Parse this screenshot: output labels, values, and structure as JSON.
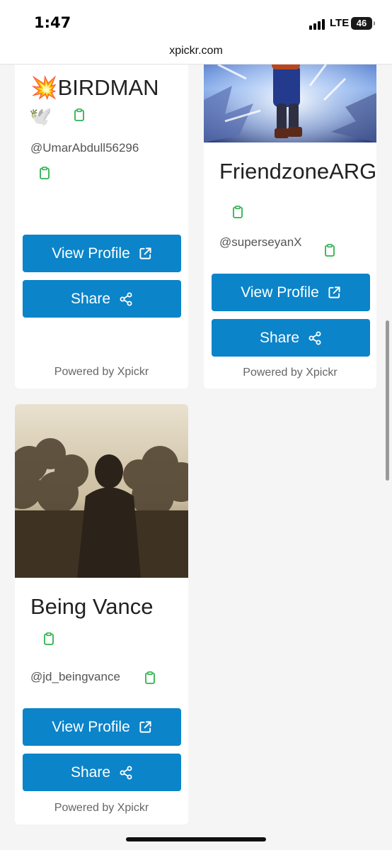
{
  "status": {
    "time": "1:47",
    "network": "LTE",
    "battery": "46"
  },
  "url": "xpickr.com",
  "cards": [
    {
      "name": "💥BIRDMAN",
      "emoji": "🕊️",
      "handle": "@UmarAbdull56296",
      "view_label": "View Profile",
      "share_label": "Share",
      "powered": "Powered by Xpickr"
    },
    {
      "name": "FriendzoneARG",
      "handle": "@superseyanX",
      "view_label": "View Profile",
      "share_label": "Share",
      "powered": "Powered by Xpickr"
    },
    {
      "name": "Being Vance",
      "handle": "@jd_beingvance",
      "view_label": "View Profile",
      "share_label": "Share",
      "powered": "Powered by Xpickr"
    }
  ],
  "colors": {
    "button": "#0b84c9",
    "clipboard_icon": "#2eb34f"
  }
}
